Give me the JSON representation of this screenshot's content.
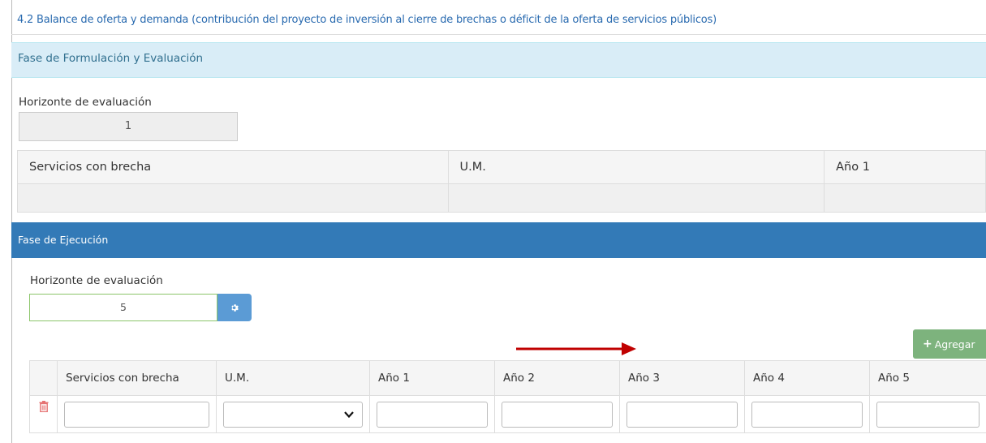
{
  "section": {
    "title": "4.2 Balance de oferta y demanda (contribución del proyecto de inversión al cierre de brechas o déficit de la oferta de servicios públicos)"
  },
  "formulacion": {
    "panel_title": "Fase de Formulación y Evaluación",
    "horizonte_label": "Horizonte de evaluación",
    "horizonte_value": "1",
    "table_headers": [
      "Servicios con brecha",
      "U.M.",
      "Año 1"
    ]
  },
  "ejecucion": {
    "panel_title": "Fase de Ejecución",
    "horizonte_label": "Horizonte de evaluación",
    "horizonte_value": "5",
    "agregar_label": "Agregar",
    "table_headers": [
      "",
      "Servicios con brecha",
      "U.M.",
      "Año 1",
      "Año 2",
      "Año 3",
      "Año 4",
      "Año 5"
    ]
  },
  "icons": {
    "gear": "gear-icon",
    "plus": "plus-icon",
    "trash": "trash-icon",
    "chevron": "chevron-down-icon",
    "arrow": "red-arrow-annotation"
  },
  "colors": {
    "link_blue": "#2a6bb0",
    "info_panel_bg": "#d9edf7",
    "primary_panel_bg": "#337ab7",
    "success_btn": "#7db37d",
    "annotation_red": "#c00000"
  }
}
